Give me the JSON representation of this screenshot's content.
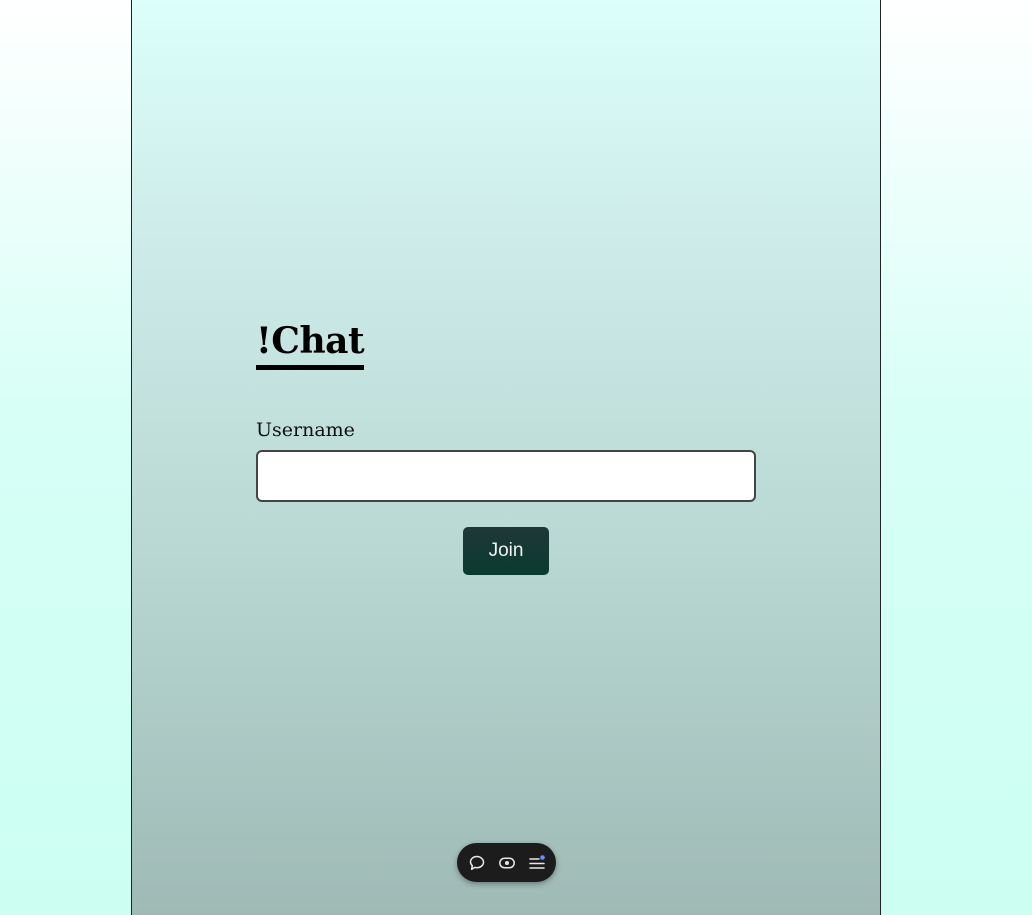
{
  "app": {
    "title": "!Chat"
  },
  "login": {
    "username_label": "Username",
    "username_value": "",
    "username_placeholder": "",
    "join_label": "Join"
  },
  "toolbar": {
    "icons": [
      "chat-bubble-icon",
      "eye-icon",
      "menu-lines-icon"
    ],
    "notification_dot_color": "#6b8cff"
  },
  "colors": {
    "join_button": "#0a3a30",
    "toolbar_bg": "#1c1c1c"
  }
}
